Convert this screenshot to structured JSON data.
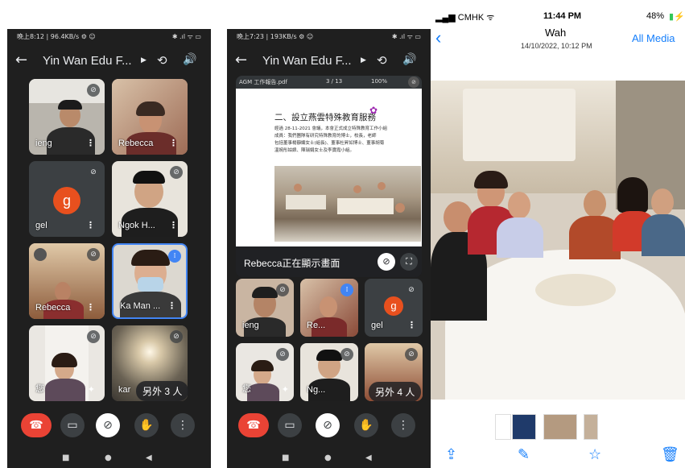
{
  "colors": {
    "meet_bg": "#1f1f1f",
    "tile_bg": "#3c4043",
    "hangup": "#ea4335",
    "active_speaker": "#4285f4",
    "ios_accent": "#147efb",
    "avatar": "#e8501e"
  },
  "screens": [
    {
      "status_left": "晚上8:12 | 96.4KB/s ⚙ ☺",
      "status_right": "✱ .ıl ᯤ ▭",
      "title": "Yin Wan Edu F...",
      "tiles": [
        {
          "name": "ieng",
          "mic": "muted"
        },
        {
          "name": "Rebecca",
          "mic": "none"
        },
        {
          "name": "gel",
          "avatar_letter": "g",
          "mic": "muted"
        },
        {
          "name": "Ngok H...",
          "mic": "muted"
        },
        {
          "name": "Rebecca",
          "mic": "muted"
        },
        {
          "name": "Ka Man ...",
          "mic": "speaking",
          "active": true
        },
        {
          "name": "您",
          "mic": "muted"
        },
        {
          "name": "kar",
          "mic": "muted"
        }
      ],
      "others_label": "另外 3 人"
    },
    {
      "status_left": "晚上7:23 | 193KB/s ⚙ ☺",
      "status_right": "✱ .ıl ᯤ ▭",
      "title": "Yin Wan Edu F...",
      "presentation": {
        "file_name": "AGM 工作報告.pdf",
        "page_indicator": "3 / 13",
        "zoom": "100%",
        "heading": "二、設立燕雲特殊教育服務",
        "body_lines": [
          "經過 28-11-2021 會議，本會正式成立特殊教育工作小組",
          "成員：我們團隊有研究特殊教育的博士，校長，老師",
          "包括董事楊靜嫻女士(組長)、董事杜昇如博士、董事胡菊",
          "溫婉彤姑娘、陳瑞娟女士及李寶霞小組。"
        ],
        "presenter_label": "Rebecca正在顯示畫面"
      },
      "tiles": [
        {
          "name": "ieng",
          "mic": "muted"
        },
        {
          "name": "Re...",
          "mic": "speaking"
        },
        {
          "name": "gel",
          "avatar_letter": "g",
          "mic": "muted"
        },
        {
          "name": "您",
          "mic": "muted"
        },
        {
          "name": "Ng...",
          "mic": "muted"
        },
        {
          "name": "",
          "mic": "muted"
        }
      ],
      "others_label": "另外 4 人"
    }
  ],
  "callbar_icons": [
    "hang-up-icon",
    "camera-icon",
    "mic-off-icon",
    "raise-hand-icon",
    "more-vert-icon"
  ],
  "ios_photo": {
    "carrier": "CMHK",
    "time": "11:44 PM",
    "battery": "48%",
    "title": "Wah",
    "subtitle": "14/10/2022, 10:12 PM",
    "right_action": "All Media",
    "toolbar_icons": [
      "share-icon",
      "markup-icon",
      "favorite-star-icon",
      "trash-icon"
    ]
  }
}
